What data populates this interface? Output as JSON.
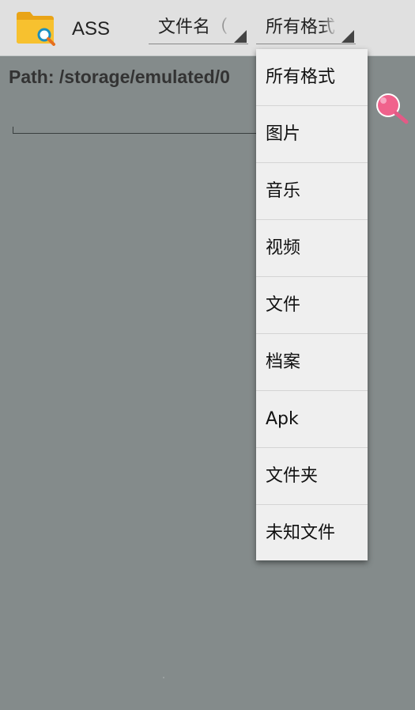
{
  "appbar": {
    "title": "ASS",
    "icon": "folder-search-icon",
    "name_spinner": {
      "selected": "文件名（"
    },
    "format_spinner": {
      "selected": "所有格式"
    }
  },
  "path": {
    "label": "Path: /storage/emulated/0"
  },
  "search": {
    "icon": "search-icon"
  },
  "dropdown": {
    "items": [
      {
        "label": "所有格式"
      },
      {
        "label": "图片"
      },
      {
        "label": "音乐"
      },
      {
        "label": "视频"
      },
      {
        "label": "文件"
      },
      {
        "label": "档案"
      },
      {
        "label": "Apk"
      },
      {
        "label": "文件夹"
      },
      {
        "label": "未知文件"
      }
    ]
  },
  "colors": {
    "background": "#848b8b",
    "appbar": "#e0e0e0",
    "dropdown": "#efefef",
    "folder": "#f7c12f",
    "search_accent": "#f0628c"
  }
}
